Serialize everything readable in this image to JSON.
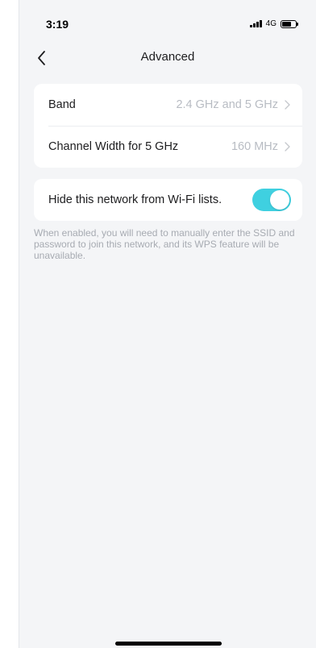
{
  "status_bar": {
    "time": "3:19",
    "network": "4G"
  },
  "nav": {
    "title": "Advanced"
  },
  "settings": {
    "band": {
      "label": "Band",
      "value": "2.4 GHz and 5 GHz"
    },
    "channel_width": {
      "label": "Channel Width for 5 GHz",
      "value": "160 MHz"
    },
    "hide_network": {
      "label": "Hide this network from Wi-Fi lists.",
      "enabled": true
    }
  },
  "help": {
    "text": "When enabled, you will need to manually enter the SSID and password to join this network, and its WPS feature will be unavailable."
  },
  "colors": {
    "toggle_on": "#3fd0e0",
    "value_text": "#b8bcc3"
  }
}
